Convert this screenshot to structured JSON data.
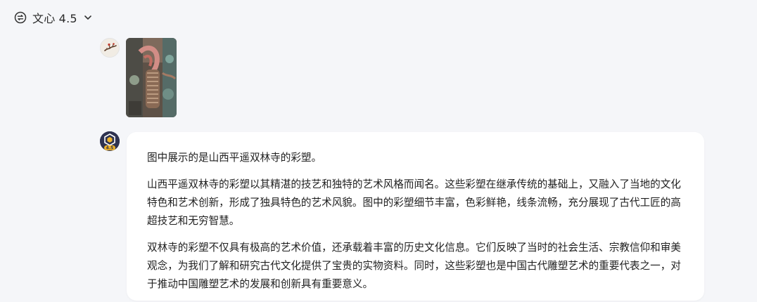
{
  "header": {
    "model_name": "文心 4.5",
    "model_icon": "model-switch-icon",
    "dropdown_icon": "chevron-down-icon"
  },
  "user_message": {
    "avatar_icon": "user-avatar",
    "image_icon": "uploaded-photo-thumbnail"
  },
  "bot_message": {
    "avatar_badge": "4.5",
    "paragraphs": [
      "图中展示的是山西平遥双林寺的彩塑。",
      "山西平遥双林寺的彩塑以其精湛的技艺和独特的艺术风格而闻名。这些彩塑在继承传统的基础上，又融入了当地的文化特色和艺术创新，形成了独具特色的艺术风貌。图中的彩塑细节丰富，色彩鲜艳，线条流畅，充分展现了古代工匠的高超技艺和无穷智慧。",
      "双林寺的彩塑不仅具有极高的艺术价值，还承载着丰富的历史文化信息。它们反映了当时的社会生活、宗教信仰和审美观念，为我们了解和研究古代文化提供了宝贵的实物资料。同时，这些彩塑也是中国古代雕塑艺术的重要代表之一，对于推动中国雕塑艺术的发展和创新具有重要意义。"
    ]
  }
}
